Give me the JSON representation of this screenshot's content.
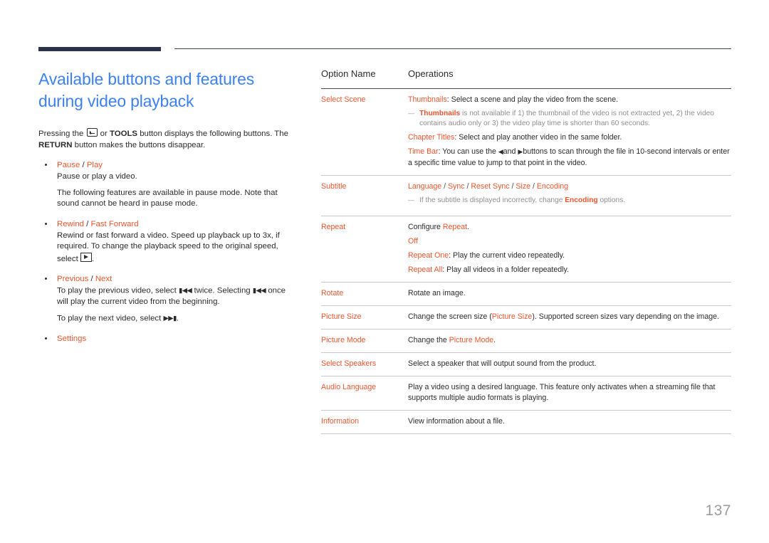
{
  "page": {
    "number": "137"
  },
  "left": {
    "title": "Available buttons and features during video playback",
    "intro_part1": "Pressing the",
    "intro_icon": "enter-key-icon",
    "intro_part2": "or",
    "intro_tools": "TOOLS",
    "intro_part3": "button displays the following buttons. The",
    "intro_return": "RETURN",
    "intro_part4": "button makes the buttons disappear.",
    "bullets": [
      {
        "head_a": "Pause",
        "head_sep": " / ",
        "head_b": "Play",
        "body": [
          "Pause or play a video.",
          "The following features are available in pause mode. Note that sound cannot be heard in pause mode."
        ]
      },
      {
        "head_a": "Rewind",
        "head_sep": " / ",
        "head_b": "Fast Forward",
        "body_prefix": "Rewind or fast forward a video. Speed up playback up to 3x, if required. To change the playback speed to the original speed, select",
        "body_icon": "play-box-icon",
        "body_suffix": "."
      },
      {
        "head_a": "Previous",
        "head_sep": " / ",
        "head_b": "Next",
        "line1_a": "To play the previous video, select",
        "line1_icon1": "skip-back-icon",
        "line1_b": "twice. Selecting",
        "line1_icon2": "skip-back-icon",
        "line1_c": "once will play the current video from the beginning.",
        "line2_a": "To play the next video, select",
        "line2_icon": "skip-forward-icon",
        "line2_b": "."
      },
      {
        "head_a": "Settings",
        "head_sep": "",
        "head_b": ""
      }
    ]
  },
  "table": {
    "headers": {
      "option_name": "Option Name",
      "operations": "Operations"
    },
    "rows": [
      {
        "name": "Select Scene",
        "lines": [
          {
            "kind": "op",
            "term": "Thumbnails",
            "text": ": Select a scene and play the video from the scene."
          },
          {
            "kind": "note",
            "term": "Thumbnails",
            "text": " is not available if 1) the thumbnail of the video is not extracted yet, 2) the video contains audio only or 3) the video play time is shorter than 60 seconds."
          },
          {
            "kind": "op",
            "term": "Chapter Titles",
            "text": ": Select and play another video in the same folder."
          },
          {
            "kind": "op_arrows",
            "term": "Time Bar",
            "text_a": ": You can use the",
            "arrow_left": "left-arrow-icon",
            "text_b": "and",
            "arrow_right": "right-arrow-icon",
            "text_c": "buttons to scan through the file in 10-second intervals or enter a specific time value to jump to that point in the video."
          }
        ]
      },
      {
        "name": "Subtitle",
        "lines": [
          {
            "kind": "terms_list",
            "terms": [
              "Language",
              "Sync",
              "Reset Sync",
              "Size",
              "Encoding"
            ],
            "separator": " / "
          },
          {
            "kind": "note_mid",
            "text_a": "If the subtitle is displayed incorrectly, change ",
            "term": "Encoding",
            "text_b": " options."
          }
        ]
      },
      {
        "name": "Repeat",
        "lines": [
          {
            "kind": "op_trailing",
            "text_a": "Configure ",
            "term": "Repeat",
            "text_b": "."
          },
          {
            "kind": "op",
            "term": "Off",
            "text": ""
          },
          {
            "kind": "op",
            "term": "Repeat One",
            "text": ": Play the current video repeatedly."
          },
          {
            "kind": "op",
            "term": "Repeat All",
            "text": ": Play all videos in a folder repeatedly."
          }
        ]
      },
      {
        "name": "Rotate",
        "lines": [
          {
            "kind": "plain",
            "text": "Rotate an image."
          }
        ]
      },
      {
        "name": "Picture Size",
        "lines": [
          {
            "kind": "op_trailing",
            "text_a": "Change the screen size (",
            "term": "Picture Size",
            "text_b": "). Supported screen sizes vary depending on the image."
          }
        ]
      },
      {
        "name": "Picture Mode",
        "lines": [
          {
            "kind": "op_trailing",
            "text_a": "Change the ",
            "term": "Picture Mode",
            "text_b": "."
          }
        ]
      },
      {
        "name": "Select Speakers",
        "lines": [
          {
            "kind": "plain",
            "text": "Select a speaker that will output sound from the product."
          }
        ]
      },
      {
        "name": "Audio Language",
        "lines": [
          {
            "kind": "plain",
            "text": "Play a video using a desired language. This feature only activates when a streaming file that supports multiple audio formats is playing."
          }
        ]
      },
      {
        "name": "Information",
        "lines": [
          {
            "kind": "plain",
            "text": "View information about a file."
          }
        ]
      }
    ]
  },
  "colors": {
    "accent_orange": "#e8552d",
    "heading_blue": "#3d81ef",
    "rule_navy": "#2c3349",
    "note_gray": "#8e8e8e",
    "page_number_gray": "#9b9b9b"
  }
}
